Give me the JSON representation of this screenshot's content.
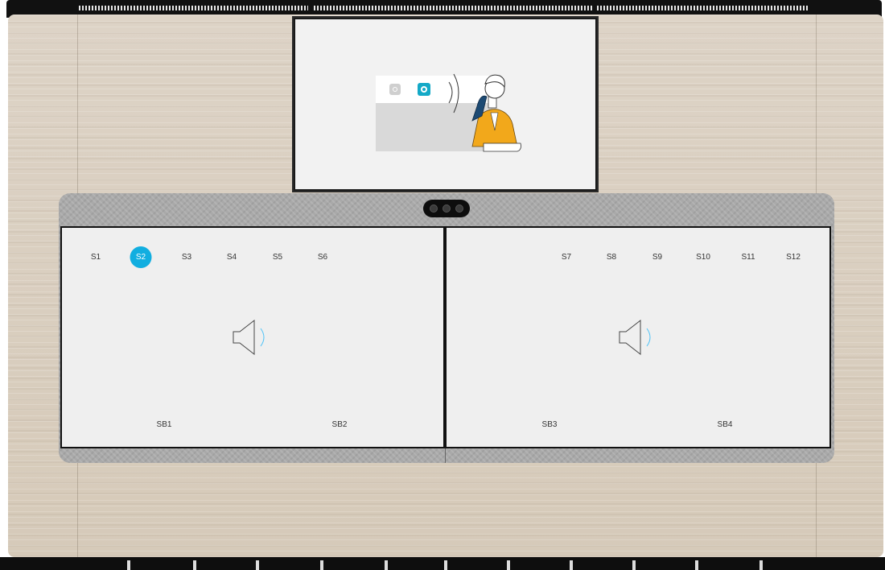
{
  "seats_left": [
    {
      "label": "S1",
      "selected": false
    },
    {
      "label": "S2",
      "selected": true
    },
    {
      "label": "S3",
      "selected": false
    },
    {
      "label": "S4",
      "selected": false
    },
    {
      "label": "S5",
      "selected": false
    },
    {
      "label": "S6",
      "selected": false
    }
  ],
  "seats_right": [
    {
      "label": "S7",
      "selected": false
    },
    {
      "label": "S8",
      "selected": false
    },
    {
      "label": "S9",
      "selected": false
    },
    {
      "label": "S10",
      "selected": false
    },
    {
      "label": "S11",
      "selected": false
    },
    {
      "label": "S12",
      "selected": false
    }
  ],
  "soundbars": {
    "sb1": "SB1",
    "sb2": "SB2",
    "sb3": "SB3",
    "sb4": "SB4"
  },
  "icons": {
    "left_speaker": "speaker-icon",
    "right_speaker": "speaker-icon",
    "mic_inactive": "microphone-icon",
    "mic_active": "microphone-icon",
    "camera": "camera-icon"
  },
  "colors": {
    "selected": "#11aee0",
    "active_mic": "#14a9c7",
    "person_jacket": "#f2a81b"
  }
}
